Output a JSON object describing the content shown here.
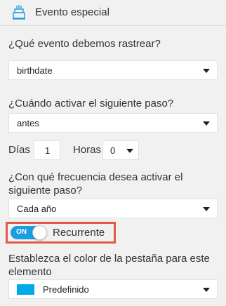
{
  "header": {
    "title": "Evento especial",
    "icon": "cake-icon"
  },
  "event_question": {
    "label": "¿Qué evento debemos rastrear?",
    "value": "birthdate"
  },
  "timing_question": {
    "label": "¿Cuándo activar el siguiente paso?",
    "value": "antes"
  },
  "offset": {
    "days_label": "Días",
    "days_value": "1",
    "hours_label": "Horas",
    "hours_value": "0"
  },
  "frequency_question": {
    "label": "¿Con qué frecuencia desea activar el siguiente paso?",
    "value": "Cada año"
  },
  "recurrence_toggle": {
    "state_text": "ON",
    "label": "Recurrente",
    "accent": "#1a9ee0",
    "highlight": "#e45a47"
  },
  "tab_color": {
    "label": "Establezca el color de la pestaña para este elemento",
    "value": "Predefinido",
    "swatch": "#00a9e8"
  }
}
